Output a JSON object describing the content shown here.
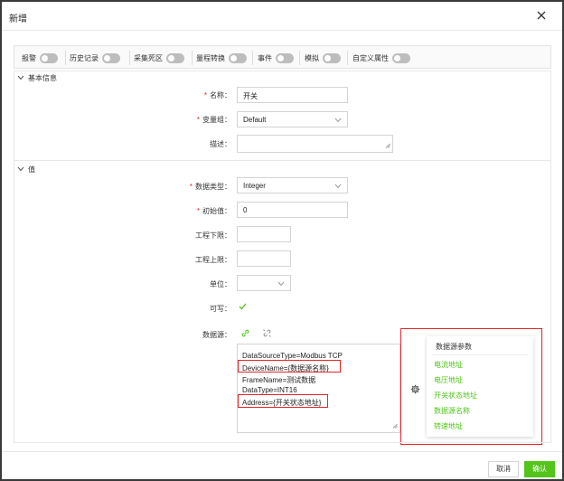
{
  "dialog": {
    "title": "新增"
  },
  "toggles": [
    {
      "label": "报警",
      "on": false
    },
    {
      "label": "历史记录",
      "on": false
    },
    {
      "label": "采集死区",
      "on": false
    },
    {
      "label": "量程转换",
      "on": false
    },
    {
      "label": "事件",
      "on": false
    },
    {
      "label": "模拟",
      "on": false
    },
    {
      "label": "自定义属性",
      "on": false
    }
  ],
  "basic": {
    "section_title": "基本信息",
    "name_label": "名称：",
    "name_value": "开关",
    "group_label": "变量组：",
    "group_value": "Default",
    "desc_label": "描述：",
    "desc_value": ""
  },
  "value": {
    "section_title": "值",
    "datatype_label": "数据类型：",
    "datatype_value": "Integer",
    "initial_label": "初始值：",
    "initial_value": "0",
    "eng_low_label": "工程下限：",
    "eng_low_value": "",
    "eng_high_label": "工程上限：",
    "eng_high_value": "",
    "unit_label": "单位：",
    "unit_value": "",
    "writable_label": "可写：",
    "writable_checked": true,
    "datasource_label": "数据源：",
    "datasource_lines": [
      "DataSourceType=Modbus TCP",
      "DeviceName={数据源名称}",
      "FrameName=测试数据",
      "DataType=INT16",
      "Address={开关状态地址}"
    ]
  },
  "popover": {
    "title": "数据源参数",
    "items": [
      "电流地址",
      "电压地址",
      "开关状态地址",
      "数据源名称",
      "转速地址"
    ]
  },
  "footer": {
    "cancel_label": "取消",
    "ok_label": "确认"
  },
  "colors": {
    "accent_green": "#52c41a",
    "required_red": "#e0252b",
    "annotation_red": "#e0252b",
    "switch_off": "#bdbdbd"
  },
  "icons": {
    "close": "close-icon",
    "chevron": "chevron-down-icon",
    "link": "link-icon",
    "unlink": "unlink-icon",
    "gear": "gear-icon",
    "check": "check-icon"
  }
}
